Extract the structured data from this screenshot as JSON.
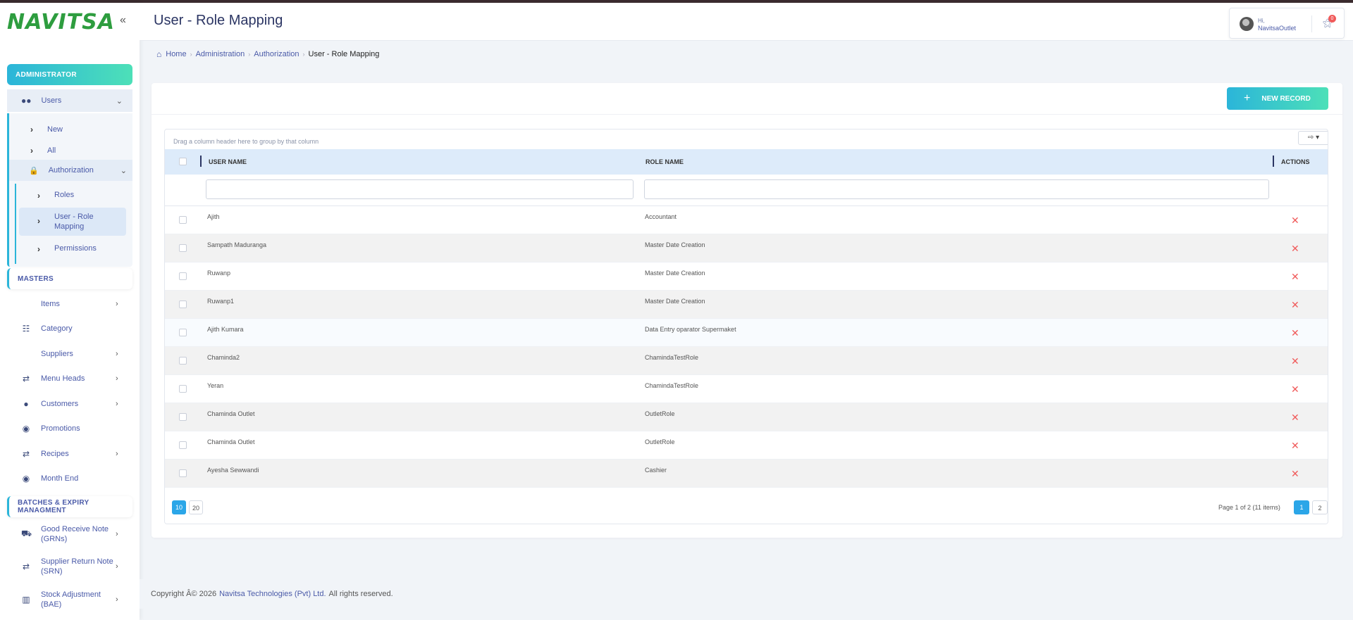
{
  "app": {
    "logo_text": "NAVITSA",
    "page_title": "User - Role Mapping"
  },
  "sidebar": {
    "sections": {
      "administrator": "ADMINISTRATOR",
      "masters": "MASTERS",
      "batches": "BATCHES & EXPIRY MANAGMENT"
    },
    "users": {
      "label": "Users",
      "children": [
        "New",
        "All"
      ],
      "authorization": {
        "label": "Authorization",
        "children": [
          "Roles",
          "User - Role Mapping",
          "Permissions"
        ]
      }
    },
    "masters_items": [
      {
        "label": "Items",
        "icon": "none",
        "chevron": true
      },
      {
        "label": "Category",
        "icon": "sitemap-icon",
        "chevron": false
      },
      {
        "label": "Suppliers",
        "icon": "none",
        "chevron": true
      },
      {
        "label": "Menu Heads",
        "icon": "exchange-icon",
        "chevron": true
      },
      {
        "label": "Customers",
        "icon": "users-icon",
        "chevron": true
      },
      {
        "label": "Promotions",
        "icon": "piggy-bank-icon",
        "chevron": false
      },
      {
        "label": "Recipes",
        "icon": "exchange-icon",
        "chevron": true
      },
      {
        "label": "Month End",
        "icon": "piggy-bank-icon",
        "chevron": false
      }
    ],
    "batch_items": [
      {
        "label": "Good Receive Note (GRNs)",
        "icon": "truck-icon"
      },
      {
        "label": "Supplier Return Note (SRN)",
        "icon": "exchange-icon"
      },
      {
        "label": "Stock Adjustment (BAE)",
        "icon": "clipboard-icon"
      }
    ]
  },
  "header": {
    "user_greeting": "Hi,",
    "user_name": "NavitsaOutlet",
    "notification_count": "0"
  },
  "breadcrumb": {
    "items": [
      "Home",
      "Administration",
      "Authorization"
    ],
    "current": "User - Role Mapping"
  },
  "toolbar": {
    "new_record_label": "NEW RECORD"
  },
  "grid": {
    "group_panel_text": "Drag a column header here to group by that column",
    "columns": {
      "user_name": "USER NAME",
      "role_name": "ROLE NAME",
      "actions": "ACTIONS"
    },
    "rows": [
      {
        "user": "Ajith",
        "role": "Accountant"
      },
      {
        "user": "Sampath Maduranga",
        "role": "Master Date Creation"
      },
      {
        "user": "Ruwanp",
        "role": "Master Date Creation"
      },
      {
        "user": "Ruwanp1",
        "role": "Master Date Creation"
      },
      {
        "user": "Ajith Kumara",
        "role": "Data Entry oparator Supermaket"
      },
      {
        "user": "Chaminda2",
        "role": "ChamindaTestRole"
      },
      {
        "user": "Yeran",
        "role": "ChamindaTestRole"
      },
      {
        "user": "Chaminda Outlet",
        "role": "OutletRole"
      },
      {
        "user": "Chaminda Outlet",
        "role": "OutletRole"
      },
      {
        "user": "Ayesha Sewwandi",
        "role": "Cashier"
      }
    ],
    "page_sizes": [
      "10",
      "20"
    ],
    "page_info": "Page 1 of 2 (11 items)",
    "pages": [
      "1",
      "2"
    ]
  },
  "footer": {
    "copyright": "Copyright Â© 2026",
    "company": "Navitsa Technologies (Pvt) Ltd.",
    "rights": "All rights reserved."
  },
  "colors": {
    "accent_gradient_start": "#2bb5d9",
    "accent_gradient_end": "#4de0b8",
    "brand_green": "#2e9d3f",
    "link_blue": "#4a5aa8",
    "delete_red": "#f05a5a",
    "header_row": "#ddebfa"
  }
}
